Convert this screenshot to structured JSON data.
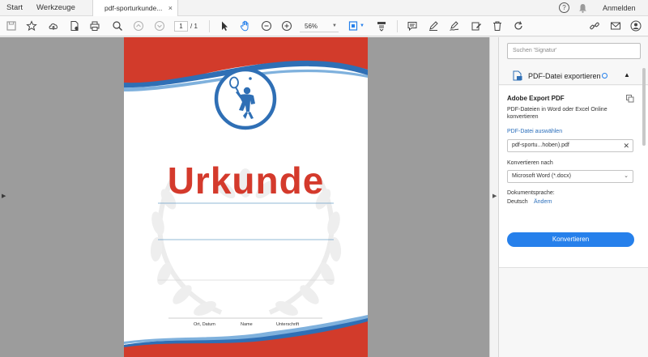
{
  "tabs": {
    "start": "Start",
    "werkzeuge": "Werkzeuge",
    "document": "pdf-sporturkunde...",
    "close": "×"
  },
  "topbar": {
    "help": "?",
    "login": "Anmelden"
  },
  "toolbar": {
    "page_current": "1",
    "page_total": "/ 1",
    "zoom": "56%"
  },
  "document": {
    "title": "Urkunde",
    "signature_labels": [
      "Ort, Datum",
      "Name",
      "Unterschrift"
    ]
  },
  "right_panel": {
    "search_placeholder": "Suchen 'Signatur'",
    "export_title": "PDF-Datei exportieren",
    "adobe_export_title": "Adobe Export PDF",
    "description": "PDF-Dateien in Word oder Excel Online konvertieren",
    "select_pdf": "PDF-Datei auswählen",
    "file_name": "pdf-sportu...hoben).pdf",
    "convert_to_label": "Konvertieren nach",
    "format": "Microsoft Word (*.docx)",
    "doc_language_label": "Dokumentsprache:",
    "doc_language": "Deutsch",
    "change": "Ändern",
    "convert_button": "Konvertieren"
  },
  "colors": {
    "accent": "#2680eb",
    "urkunde_red": "#d43a2c",
    "header_red": "#d23b2b",
    "header_blue": "#2f6fb5"
  }
}
